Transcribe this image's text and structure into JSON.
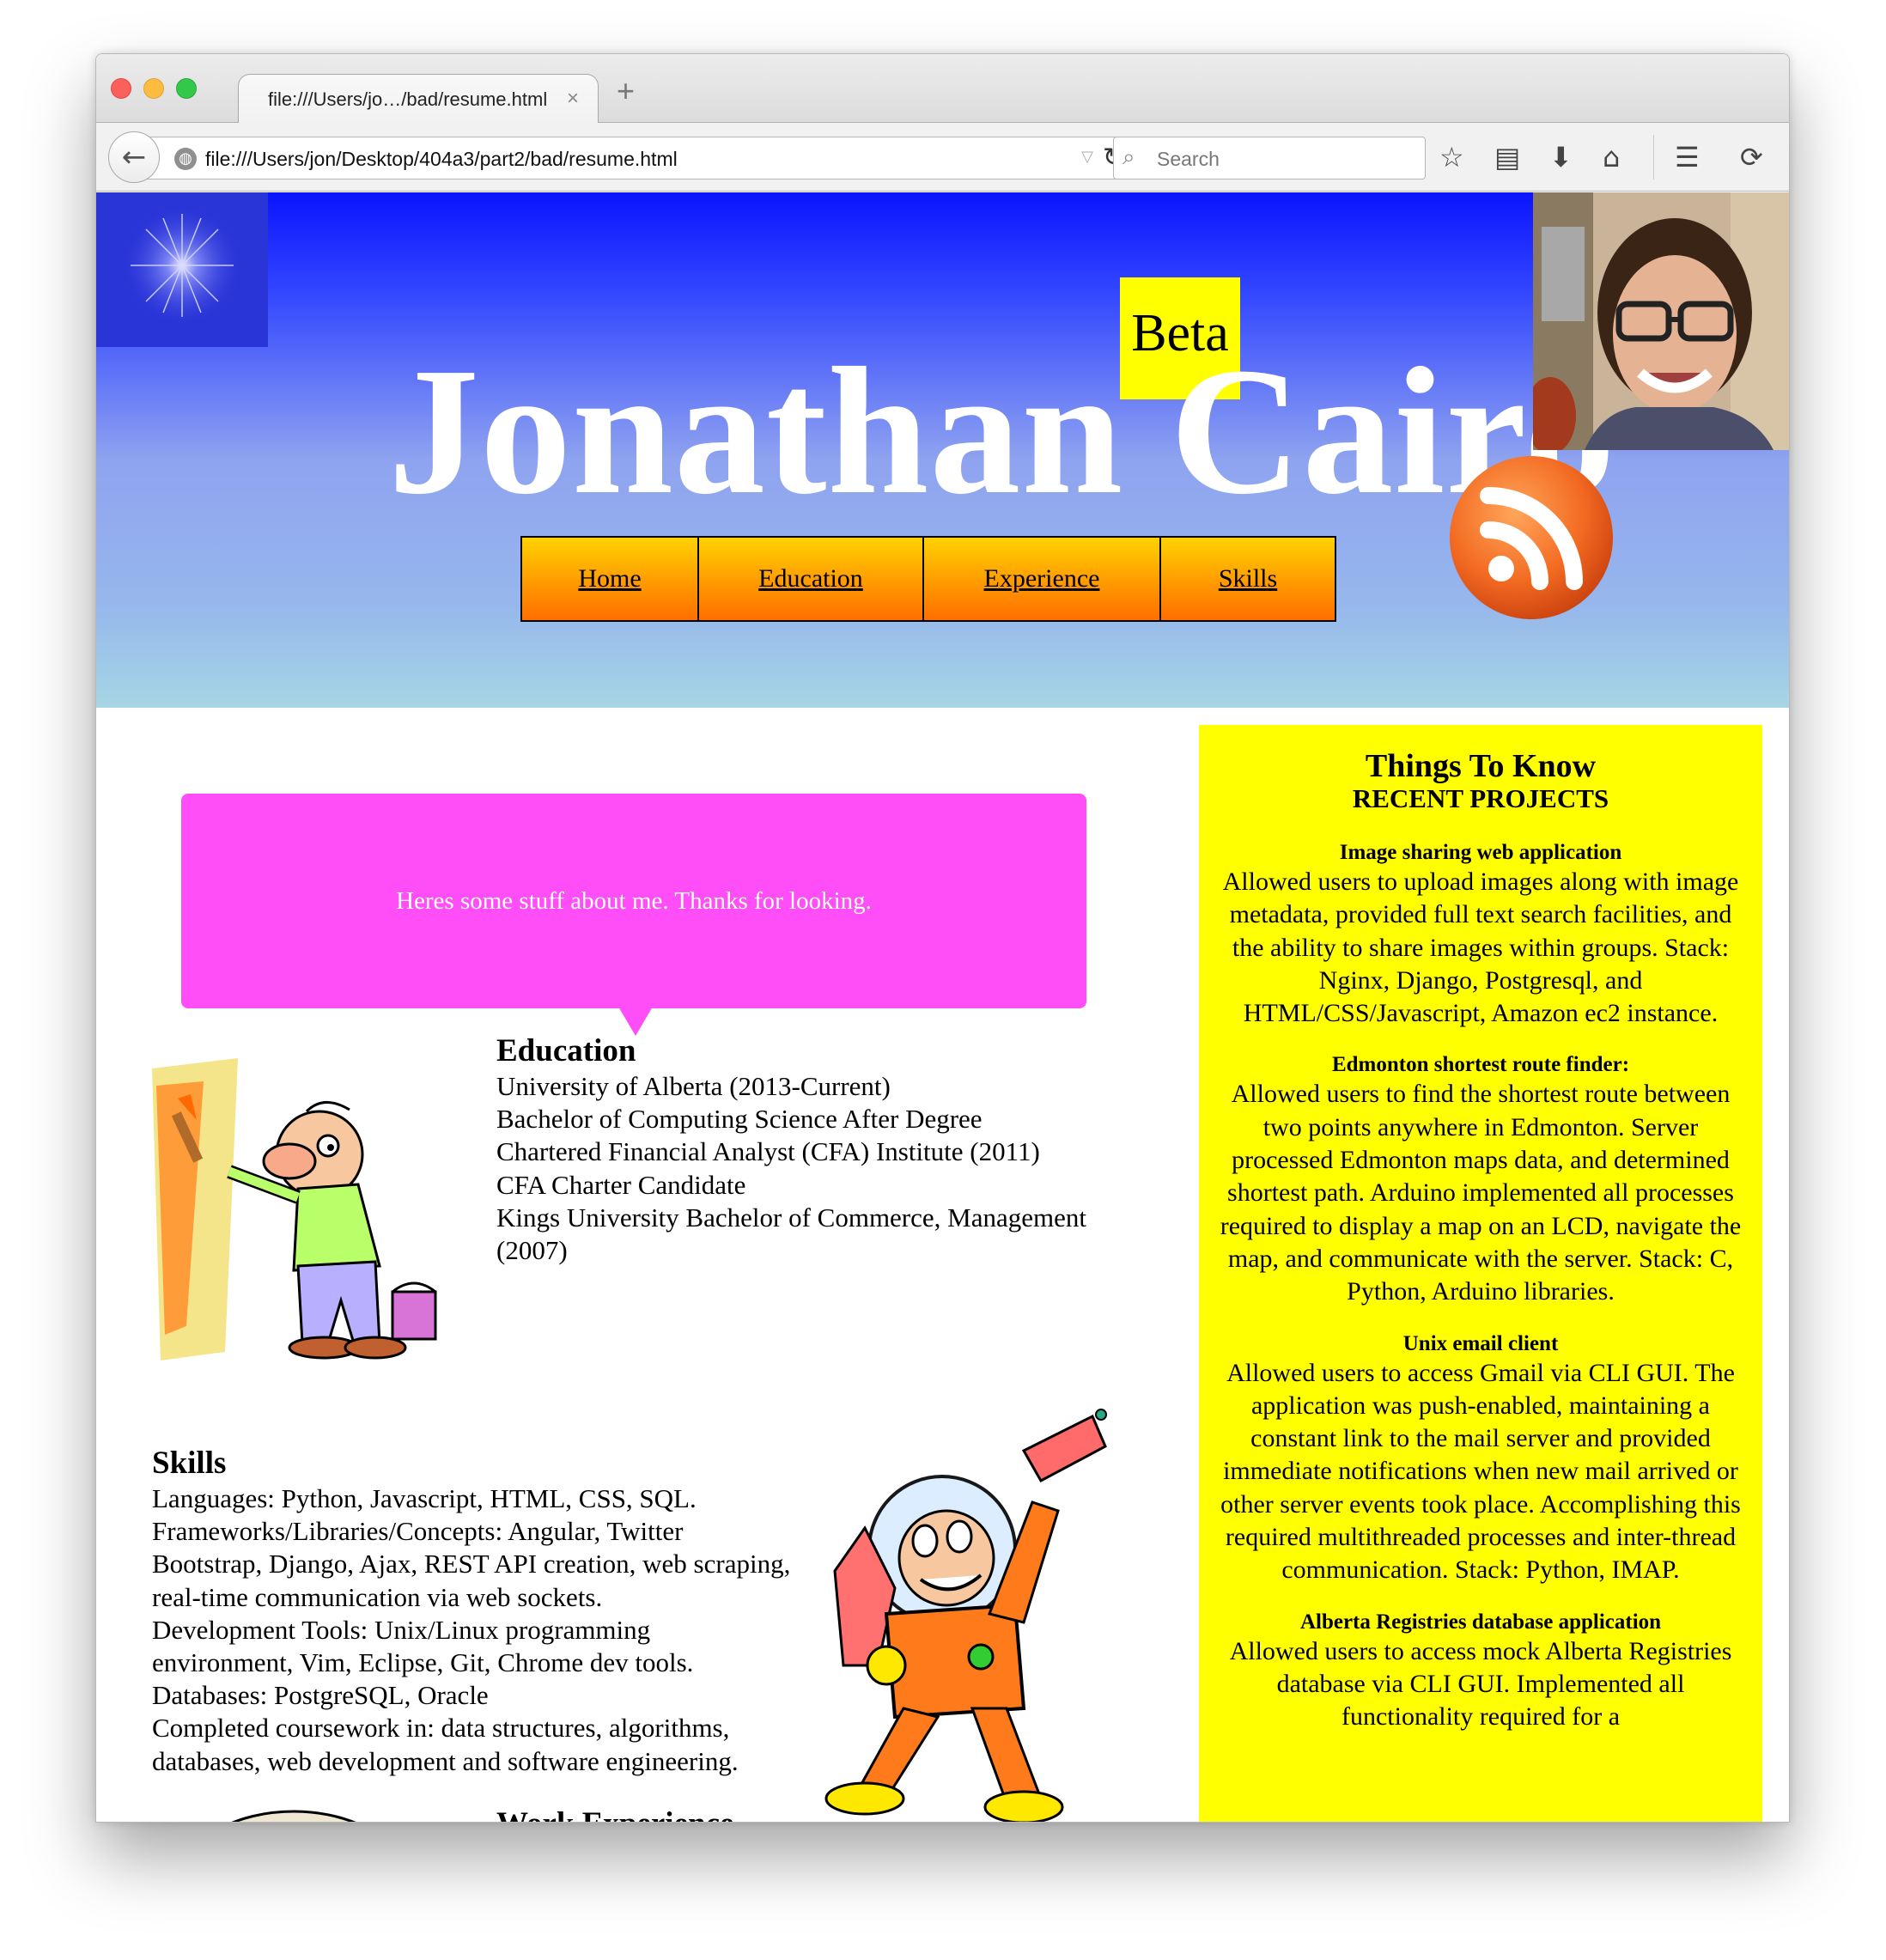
{
  "browser": {
    "tab_title": "file:///Users/jo…/bad/resume.html",
    "tab_close": "×",
    "new_tab": "+",
    "url": "file:///Users/jon/Desktop/404a3/part2/bad/resume.html",
    "search_placeholder": "Search",
    "icons": [
      "back-arrow-icon",
      "globe-icon",
      "reload-icon",
      "search-icon",
      "bookmark-star-icon",
      "reading-list-icon",
      "download-icon",
      "home-icon",
      "menu-icon",
      "sync-icon"
    ]
  },
  "header": {
    "beta": "Beta",
    "name": "Jonathan Cairo",
    "nav": [
      "Home",
      "Education",
      "Experience",
      "Skills"
    ],
    "colors": {
      "header_top": "#0b14ff",
      "header_bottom": "#a6d6e5",
      "nav_button": "#ff9a00",
      "beta_bg": "#ffff00"
    }
  },
  "about": {
    "text": "Heres some stuff about me. Thanks for looking.",
    "color": "#ff4df7"
  },
  "education": {
    "heading": "Education",
    "lines": [
      "University of Alberta (2013-Current)",
      "Bachelor of Computing Science After Degree",
      "Chartered Financial Analyst (CFA) Institute (2011)",
      "CFA Charter Candidate",
      "Kings University Bachelor of Commerce, Management (2007)"
    ]
  },
  "skills": {
    "heading": "Skills",
    "lines": [
      "Languages: Python, Javascript, HTML, CSS, SQL.",
      "Frameworks/Libraries/Concepts: Angular, Twitter Bootstrap, Django, Ajax, REST API creation, web scraping, real-time communication via web sockets.",
      "Development Tools: Unix/Linux programming environment, Vim, Eclipse, Git, Chrome dev tools.",
      "Databases: PostgreSQL, Oracle",
      "Completed coursework in: data structures, algorithms, databases, web development and software engineering."
    ]
  },
  "work": {
    "heading": "Work Experience"
  },
  "sidebar": {
    "title": "Things To Know",
    "subtitle": "RECENT PROJECTS",
    "projects": [
      {
        "name": "Image sharing web application",
        "desc": "Allowed users to upload images along with image metadata, provided full text search facilities, and the ability to share images within groups. Stack: Nginx, Django, Postgresql, and HTML/CSS/Javascript, Amazon ec2 instance."
      },
      {
        "name": "Edmonton shortest route finder:",
        "desc": "Allowed users to find the shortest route between two points anywhere in Edmonton. Server processed Edmonton maps data, and determined shortest path. Arduino implemented all processes required to display a map on an LCD, navigate the map, and communicate with the server. Stack: C, Python, Arduino libraries."
      },
      {
        "name": "Unix email client",
        "desc": "Allowed users to access Gmail via CLI GUI. The application was push-enabled, maintaining a constant link to the mail server and provided immediate notifications when new mail arrived or other server events took place. Accomplishing this required multithreaded processes and inter-thread communication. Stack: Python, IMAP."
      },
      {
        "name": "Alberta Registries database application",
        "desc": "Allowed users to access mock Alberta Registries database via CLI GUI. Implemented all functionality required for a"
      }
    ]
  }
}
